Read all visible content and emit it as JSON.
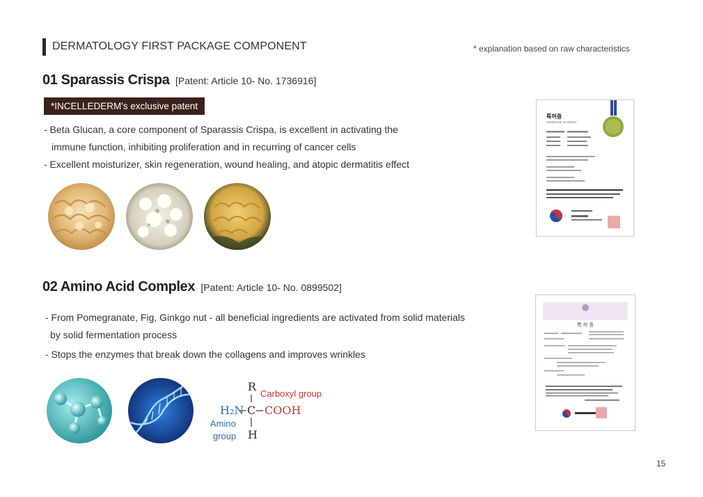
{
  "header": {
    "title": "DERMATOLOGY FIRST PACKAGE COMPONENT",
    "note": "* explanation based on raw characteristics"
  },
  "section1": {
    "title": "01 Sparassis Crispa",
    "patent": "[Patent: Article 10- No. 1736916]",
    "tag": "*INCELLEDERM's exclusive patent",
    "bullets": [
      "- Beta Glucan, a core component of Sparassis Crispa, is excellent in activating the",
      "immune function, inhibiting proliferation and in recurring of cancer cells",
      "- Excellent moisturizer, skin regeneration, wound healing, and atopic dermatitis effect"
    ]
  },
  "section2": {
    "title": "02 Amino Acid Complex",
    "patent": "[Patent: Article 10- No. 0899502]",
    "bullets": [
      "- From Pomegranate, Fig, Ginkgo nut - all beneficial ingredients are activated from solid materials",
      "by solid fermentation process",
      "- Stops the enzymes that break down the collagens and improves wrinkles"
    ]
  },
  "formula": {
    "r": "R",
    "carboxyl_label": "Carboxyl group",
    "amine": "H₂N",
    "center": "C",
    "cooh": "COOH",
    "h": "H",
    "amino_label_1": "Amino",
    "amino_label_2": "group"
  },
  "certificate1": {
    "title": "특허증",
    "subtitle": "CERTIFICATE OF PATENT"
  },
  "certificate2": {
    "title": "특 허 증"
  },
  "page_number": "15",
  "colors": {
    "accent_dark": "#3a211a",
    "carboxyl": "#c0392b",
    "amino": "#2c6fb3"
  }
}
